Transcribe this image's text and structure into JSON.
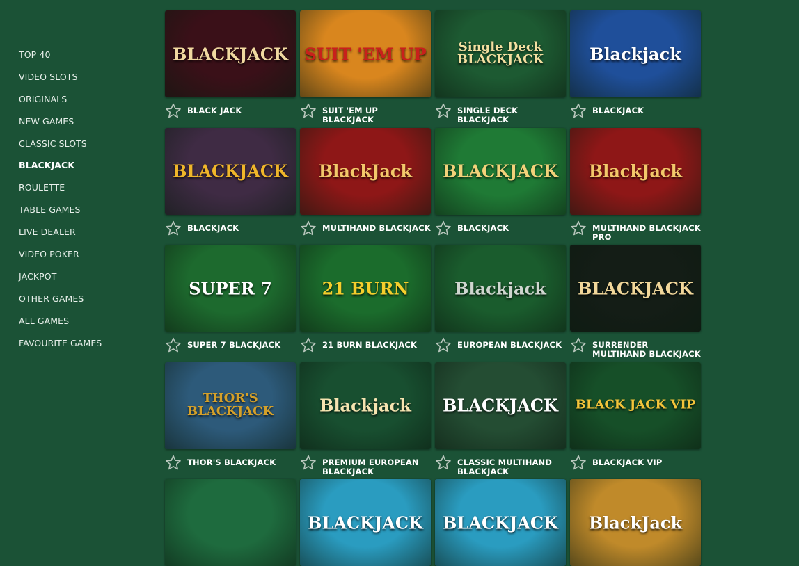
{
  "sidebar": {
    "items": [
      {
        "label": "TOP 40",
        "active": false
      },
      {
        "label": "VIDEO SLOTS",
        "active": false
      },
      {
        "label": "ORIGINALS",
        "active": false
      },
      {
        "label": "NEW GAMES",
        "active": false
      },
      {
        "label": "CLASSIC SLOTS",
        "active": false
      },
      {
        "label": "BLACKJACK",
        "active": true
      },
      {
        "label": "ROULETTE",
        "active": false
      },
      {
        "label": "TABLE GAMES",
        "active": false
      },
      {
        "label": "LIVE DEALER",
        "active": false
      },
      {
        "label": "VIDEO POKER",
        "active": false
      },
      {
        "label": "JACKPOT",
        "active": false
      },
      {
        "label": "OTHER GAMES",
        "active": false
      },
      {
        "label": "ALL GAMES",
        "active": false
      },
      {
        "label": "FAVOURITE GAMES",
        "active": false
      }
    ]
  },
  "icons": {
    "favourite": "star-outline-icon"
  },
  "colors": {
    "page_bg": "#1b5236",
    "text": "#ffffff",
    "star": "#b9c7bd"
  },
  "games": [
    {
      "name": "BLACK JACK",
      "thumb_text": "BLACKJACK",
      "bg": "#3a1018",
      "accent": "#f1d9a0"
    },
    {
      "name": "SUIT 'EM UP BLACKJACK",
      "thumb_text": "SUIT 'EM UP",
      "bg": "#d9861e",
      "accent": "#c8201c"
    },
    {
      "name": "SINGLE DECK BLACKJACK",
      "thumb_text": "Single Deck BLACKJACK",
      "bg": "#1d5a32",
      "accent": "#f3dfa0"
    },
    {
      "name": "BLACKJACK",
      "thumb_text": "Blackjack",
      "bg": "#1f4f9a",
      "accent": "#ffffff"
    },
    {
      "name": "BLACKJACK",
      "thumb_text": "BLACKJACK",
      "bg": "#3f2b44",
      "accent": "#f0b62a"
    },
    {
      "name": "MULTIHAND BLACKJACK",
      "thumb_text": "BlackJack",
      "bg": "#8e1717",
      "accent": "#f3c86a"
    },
    {
      "name": "BLACKJACK",
      "thumb_text": "BLACKJACK",
      "bg": "#1f7a35",
      "accent": "#f2d27a"
    },
    {
      "name": "MULTIHAND BLACKJACK PRO",
      "thumb_text": "BlackJack",
      "bg": "#8e1717",
      "accent": "#f3c86a"
    },
    {
      "name": "SUPER 7 BLACKJACK",
      "thumb_text": "SUPER 7",
      "bg": "#1d6a2e",
      "accent": "#ffffff"
    },
    {
      "name": "21 BURN BLACKJACK",
      "thumb_text": "21 BURN",
      "bg": "#1b6c2c",
      "accent": "#f5cf2c"
    },
    {
      "name": "EUROPEAN BLACKJACK",
      "thumb_text": "Blackjack",
      "bg": "#1a5c2d",
      "accent": "#cfd6cf"
    },
    {
      "name": "SURRENDER MULTIHAND BLACKJACK",
      "thumb_text": "BLACKJACK",
      "bg": "#141d16",
      "accent": "#f1d79a"
    },
    {
      "name": "THOR'S BLACKJACK",
      "thumb_text": "THOR'S BLACKJACK",
      "bg": "#2d5a7a",
      "accent": "#d4a02a"
    },
    {
      "name": "PREMIUM EUROPEAN BLACKJACK",
      "thumb_text": "Blackjack",
      "bg": "#184f30",
      "accent": "#f5e4b0"
    },
    {
      "name": "CLASSIC MULTIHAND BLACKJACK",
      "thumb_text": "BLACKJACK",
      "bg": "#244d33",
      "accent": "#ffffff"
    },
    {
      "name": "BLACKJACK VIP",
      "thumb_text": "BLACK JACK VIP",
      "bg": "#164f28",
      "accent": "#f3c43a"
    },
    {
      "name": "",
      "thumb_text": "",
      "bg": "#1e6b3e",
      "accent": "#ffffff"
    },
    {
      "name": "",
      "thumb_text": "BLACKJACK",
      "bg": "#2a9cc0",
      "accent": "#ffffff"
    },
    {
      "name": "",
      "thumb_text": "BLACKJACK",
      "bg": "#2a9cc0",
      "accent": "#ffffff"
    },
    {
      "name": "",
      "thumb_text": "BlackJack",
      "bg": "#c08a2a",
      "accent": "#ffffff"
    }
  ]
}
